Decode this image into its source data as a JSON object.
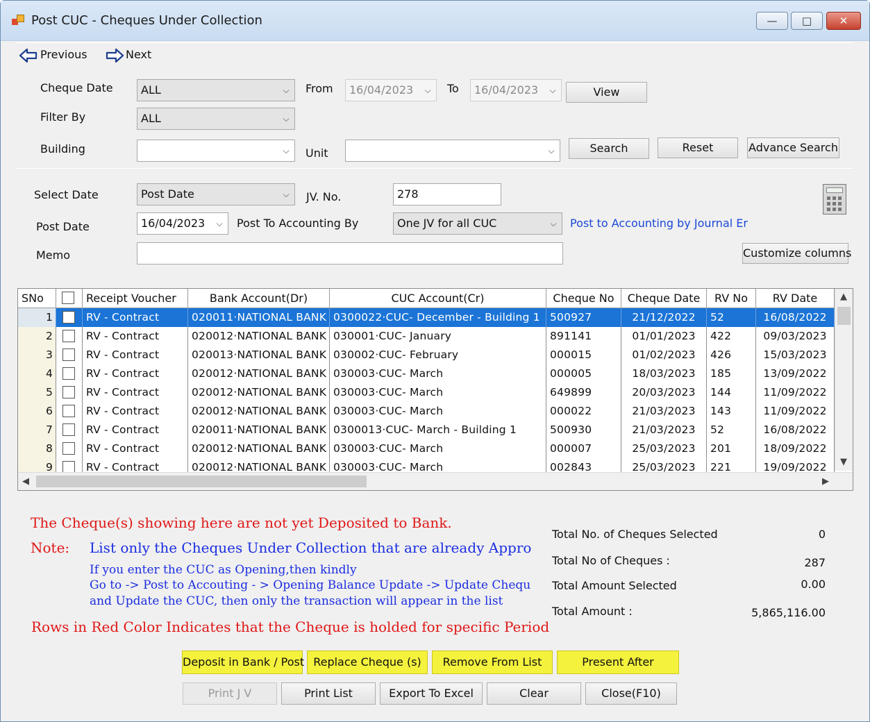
{
  "window": {
    "title": "Post CUC - Cheques Under Collection",
    "controls": [
      "—",
      "□",
      "✕"
    ]
  },
  "nav": {
    "previous": "Previous",
    "next": "Next"
  },
  "filters": {
    "cheque_date_label": "Cheque Date",
    "cheque_date_value": "ALL",
    "from_label": "From",
    "from_value": "16/04/2023",
    "to_label": "To",
    "to_value": "16/04/2023",
    "view_btn": "View",
    "filter_by_label": "Filter By",
    "filter_by_value": "ALL",
    "building_label": "Building",
    "building_value": "",
    "unit_label": "Unit",
    "unit_value": "",
    "search_btn": "Search",
    "reset_btn": "Reset",
    "advance_search_btn": "Advance Search"
  },
  "posting": {
    "select_date_label": "Select Date",
    "select_date_value": "Post Date",
    "jv_no_label": "JV. No.",
    "jv_no_value": "278",
    "post_date_label": "Post Date",
    "post_date_value": "16/04/2023",
    "post_by_label": "Post To Accounting By",
    "post_by_value": "One JV for all CUC",
    "post_link": "Post to Accounting by Journal Er",
    "memo_label": "Memo",
    "memo_value": "",
    "customize_btn": "Customize columns"
  },
  "grid": {
    "columns": [
      "SNo",
      "",
      "Receipt Voucher",
      "Bank Account(Dr)",
      "CUC Account(Cr)",
      "Cheque No",
      "Cheque Date",
      "RV No",
      "RV Date"
    ],
    "rows": [
      {
        "sno": "1",
        "rv": "RV - Contract",
        "bank": "020011·NATIONAL BANK",
        "cuc": "0300022·CUC- December - Building 1",
        "cheque_no": "500927",
        "cheque_date": "21/12/2022",
        "rv_no": "52",
        "rv_date": "16/08/2022"
      },
      {
        "sno": "2",
        "rv": "RV - Contract",
        "bank": "020012·NATIONAL BANK",
        "cuc": "030001·CUC- January",
        "cheque_no": "891141",
        "cheque_date": "01/01/2023",
        "rv_no": "422",
        "rv_date": "09/03/2023"
      },
      {
        "sno": "3",
        "rv": "RV - Contract",
        "bank": "020013·NATIONAL BANK",
        "cuc": "030002·CUC- February",
        "cheque_no": "000015",
        "cheque_date": "01/02/2023",
        "rv_no": "426",
        "rv_date": "15/03/2023"
      },
      {
        "sno": "4",
        "rv": "RV - Contract",
        "bank": "020012·NATIONAL BANK",
        "cuc": "030003·CUC- March",
        "cheque_no": "000005",
        "cheque_date": "18/03/2023",
        "rv_no": "185",
        "rv_date": "13/09/2022"
      },
      {
        "sno": "5",
        "rv": "RV - Contract",
        "bank": "020012·NATIONAL BANK",
        "cuc": "030003·CUC- March",
        "cheque_no": "649899",
        "cheque_date": "20/03/2023",
        "rv_no": "144",
        "rv_date": "11/09/2022"
      },
      {
        "sno": "6",
        "rv": "RV - Contract",
        "bank": "020012·NATIONAL BANK",
        "cuc": "030003·CUC- March",
        "cheque_no": "000022",
        "cheque_date": "21/03/2023",
        "rv_no": "143",
        "rv_date": "11/09/2022"
      },
      {
        "sno": "7",
        "rv": "RV - Contract",
        "bank": "020011·NATIONAL BANK",
        "cuc": "0300013·CUC- March  - Building 1",
        "cheque_no": "500930",
        "cheque_date": "21/03/2023",
        "rv_no": "52",
        "rv_date": "16/08/2022"
      },
      {
        "sno": "8",
        "rv": "RV - Contract",
        "bank": "020012·NATIONAL BANK",
        "cuc": "030003·CUC- March",
        "cheque_no": "000007",
        "cheque_date": "25/03/2023",
        "rv_no": "201",
        "rv_date": "18/09/2022"
      },
      {
        "sno": "9",
        "rv": "RV - Contract",
        "bank": "020012·NATIONAL BANK",
        "cuc": "030003·CUC- March",
        "cheque_no": "002843",
        "cheque_date": "25/03/2023",
        "rv_no": "221",
        "rv_date": "19/09/2022"
      }
    ]
  },
  "notes": {
    "line1": "The Cheque(s) showing here are not yet Deposited to Bank.",
    "note_label": "Note:",
    "line2": "List only the Cheques Under Collection that are already Approved from I",
    "line3": "If you enter the CUC as Opening,then kindly",
    "line4": "Go to -> Post to Accouting - > Opening Balance Update -> Update Cheques Unc",
    "line5": "and Update the CUC, then only the transaction will appear in the list",
    "line6": "Rows in Red Color Indicates that the Cheque is holded for specific Period"
  },
  "totals": {
    "selected_count_label": "Total No. of Cheques  Selected",
    "selected_count_value": "0",
    "count_label": "Total No of Cheques :",
    "count_value": "287",
    "amount_selected_label": "Total Amount Selected",
    "amount_selected_value": "0.00",
    "amount_label": "Total Amount :",
    "amount_value": "5,865,116.00"
  },
  "actions": {
    "deposit": "Deposit in Bank / Post",
    "replace": "Replace Cheque (s)",
    "remove": "Remove From List",
    "present_after": "Present After",
    "print_jv": "Print J V",
    "print_list": "Print List",
    "export_excel": "Export To Excel",
    "clear": "Clear",
    "close": "Close(F10)"
  },
  "colors": {
    "selection": "#1b74d6",
    "highlight_buttons": "#f4f23c",
    "note_red": "#e01717",
    "note_blue": "#1b2ee0"
  }
}
